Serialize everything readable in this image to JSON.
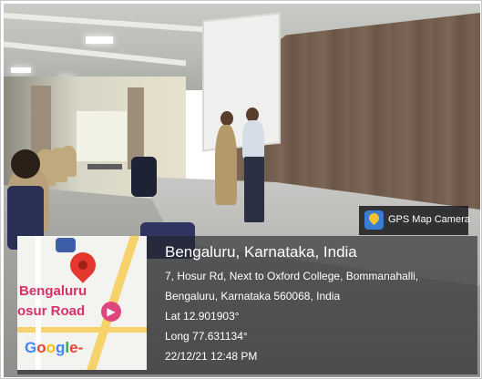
{
  "badge": {
    "label": "GPS Map Camera",
    "icon": "gps-map-camera-icon"
  },
  "map": {
    "place_line1": "Bengaluru",
    "place_line2": "osur Road",
    "logo": [
      "G",
      "o",
      "o",
      "g",
      "l",
      "e",
      "-"
    ],
    "pin_icon": "map-pin-icon",
    "hotel_icon": "hotel-icon",
    "transit_icon": "transit-icon"
  },
  "location": {
    "title": "Bengaluru, Karnataka, India",
    "address_line1": "7, Hosur Rd, Next to Oxford College, Bommanahalli,",
    "address_line2": "Bengaluru, Karnataka 560068, India",
    "latitude": "Lat 12.901903°",
    "longitude": "Long 77.631134°",
    "datetime": "22/12/21 12:48 PM"
  }
}
